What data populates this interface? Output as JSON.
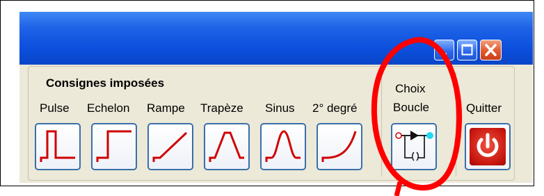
{
  "group": {
    "title": "Consignes imposées"
  },
  "buttons": [
    {
      "label": "Pulse",
      "icon": "pulse-signal-icon"
    },
    {
      "label": "Echelon",
      "icon": "step-signal-icon"
    },
    {
      "label": "Rampe",
      "icon": "ramp-signal-icon"
    },
    {
      "label": "Trapèze",
      "icon": "trapezoid-signal-icon"
    },
    {
      "label": "Sinus",
      "icon": "sine-signal-icon"
    },
    {
      "label": "2° degré",
      "icon": "second-degree-signal-icon"
    }
  ],
  "choix": {
    "line1": "Choix",
    "line2": "Boucle",
    "icon": "loop-diagram-icon"
  },
  "quit": {
    "label": "Quitter",
    "icon": "power-icon"
  },
  "colors": {
    "signal": "#d00000",
    "annotation": "#ff0000",
    "titlebar": "#0b4fdc",
    "panel": "#ece9d8"
  }
}
